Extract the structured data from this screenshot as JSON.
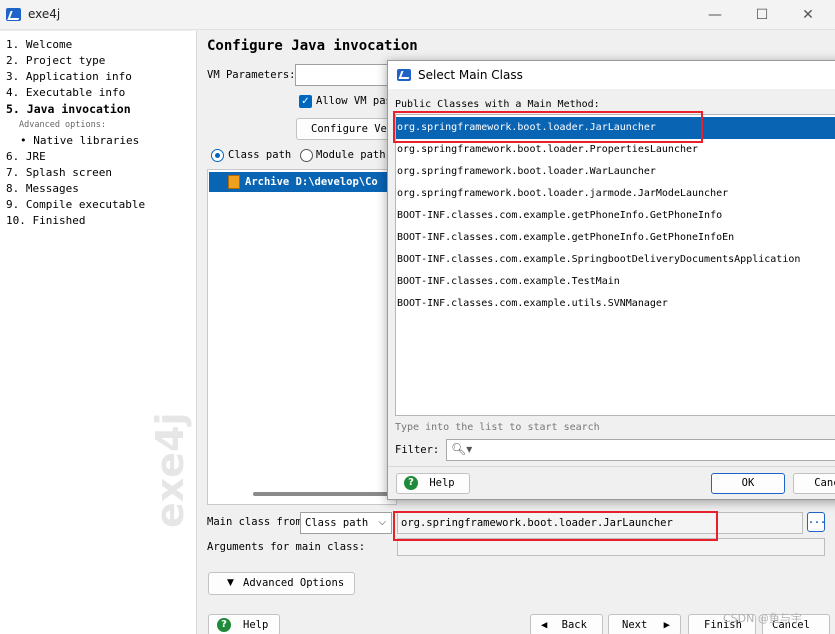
{
  "window": {
    "title": "exe4j",
    "minimize": "—",
    "maximize": "☐",
    "close": "✕"
  },
  "nav": {
    "items": [
      "1.  Welcome",
      "2.  Project type",
      "3.  Application info",
      "4.  Executable info",
      "5.  Java invocation",
      "6.  JRE",
      "7.  Splash screen",
      "8.  Messages",
      "9.  Compile executable",
      "10.  Finished"
    ],
    "advanced_label": "Advanced options:",
    "native_libraries": "• Native libraries",
    "watermark": "exe4j"
  },
  "main": {
    "title": "Configure Java invocation",
    "vm_label": "VM Parameters:",
    "allow_vm_label": "Allow VM pas",
    "configure_button": "Configure Ver",
    "class_path_radio": "Class path",
    "module_path_radio": "Module path",
    "class_path_entry": "Archive D:\\develop\\Co",
    "main_class_label": "Main class from",
    "main_class_source": "Class path",
    "main_class_value": "org.springframework.boot.loader.JarLauncher",
    "main_class_browse": "...",
    "arguments_label": "Arguments for main class:",
    "advanced_options_button": "Advanced Options"
  },
  "footer": {
    "help": "Help",
    "back": "Back",
    "next": "Next",
    "finish": "Finish",
    "cancel": "Cancel",
    "back_arrow": "◀",
    "next_arrow": "▶"
  },
  "dialog": {
    "title": "Select Main Class",
    "caption": "Public Classes with a Main Method:",
    "classes": [
      "org.springframework.boot.loader.JarLauncher",
      "org.springframework.boot.loader.PropertiesLauncher",
      "org.springframework.boot.loader.WarLauncher",
      "org.springframework.boot.loader.jarmode.JarModeLauncher",
      "BOOT-INF.classes.com.example.getPhoneInfo.GetPhoneInfo",
      "BOOT-INF.classes.com.example.getPhoneInfo.GetPhoneInfoEn",
      "BOOT-INF.classes.com.example.SpringbootDeliveryDocumentsApplication",
      "BOOT-INF.classes.com.example.TestMain",
      "BOOT-INF.classes.com.example.utils.SVNManager"
    ],
    "selected_index": 0,
    "hint": "Type into the list to start search",
    "filter_label": "Filter:",
    "help": "Help",
    "ok": "OK",
    "cancel": "Cance"
  },
  "watermark_text": "CSDN @鱼与宇"
}
